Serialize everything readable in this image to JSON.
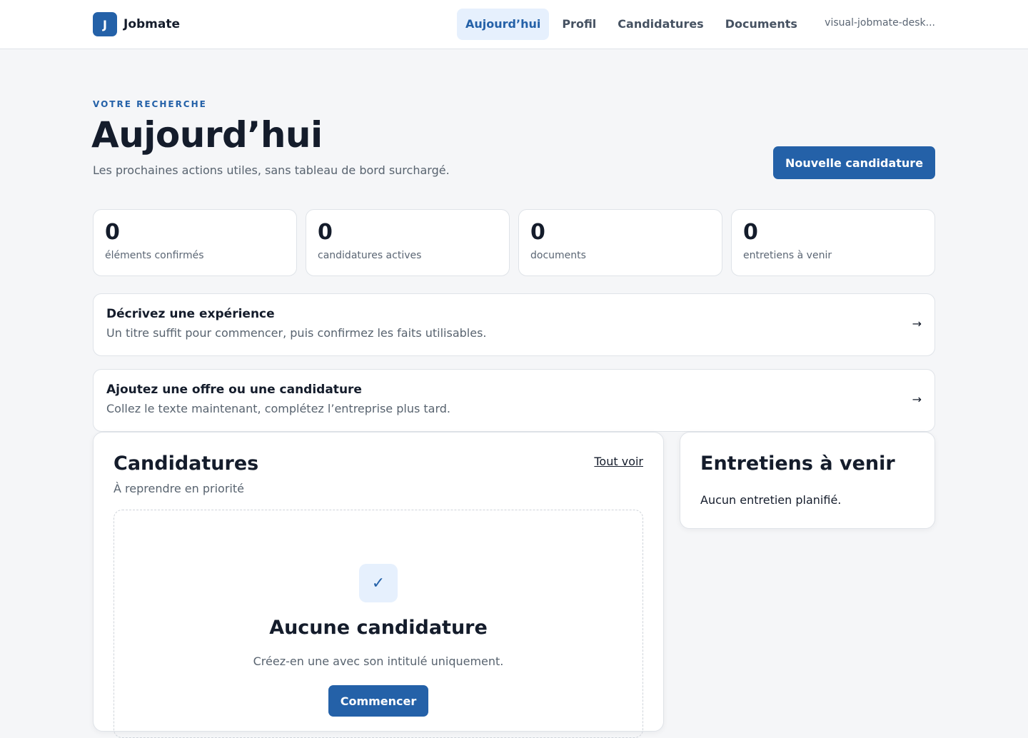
{
  "brand": {
    "initial": "J",
    "name": "Jobmate"
  },
  "nav": {
    "items": [
      {
        "label": "Aujourd’hui",
        "active": true
      },
      {
        "label": "Profil",
        "active": false
      },
      {
        "label": "Candidatures",
        "active": false
      },
      {
        "label": "Documents",
        "active": false
      }
    ],
    "workspace": "visual-jobmate-desk..."
  },
  "header": {
    "eyebrow": "VOTRE RECHERCHE",
    "title": "Aujourd’hui",
    "subtitle": "Les prochaines actions utiles, sans tableau de bord surchargé.",
    "new_application_label": "Nouvelle candidature"
  },
  "stats": [
    {
      "value": "0",
      "label": "éléments confirmés"
    },
    {
      "value": "0",
      "label": "candidatures actives"
    },
    {
      "value": "0",
      "label": "documents"
    },
    {
      "value": "0",
      "label": "entretiens à venir"
    }
  ],
  "actions": [
    {
      "title": "Décrivez une expérience",
      "description": "Un titre suffit pour commencer, puis confirmez les faits utilisables.",
      "arrow": "→"
    },
    {
      "title": "Ajoutez une offre ou une candidature",
      "description": "Collez le texte maintenant, complétez l’entreprise plus tard.",
      "arrow": "→"
    }
  ],
  "applications_panel": {
    "title": "Candidatures",
    "subtitle": "À reprendre en priorité",
    "see_all": "Tout voir",
    "empty": {
      "icon": "check-icon",
      "glyph": "✓",
      "title": "Aucune candidature",
      "description": "Créez-en une avec son intitulé uniquement.",
      "button": "Commencer"
    }
  },
  "interviews_panel": {
    "title": "Entretiens à venir",
    "empty": "Aucun entretien planifié."
  },
  "colors": {
    "accent": "#2461a8",
    "accent_soft": "#e6f0fd",
    "background": "#f5f6f8",
    "text": "#141c2b",
    "muted": "#58636f"
  }
}
